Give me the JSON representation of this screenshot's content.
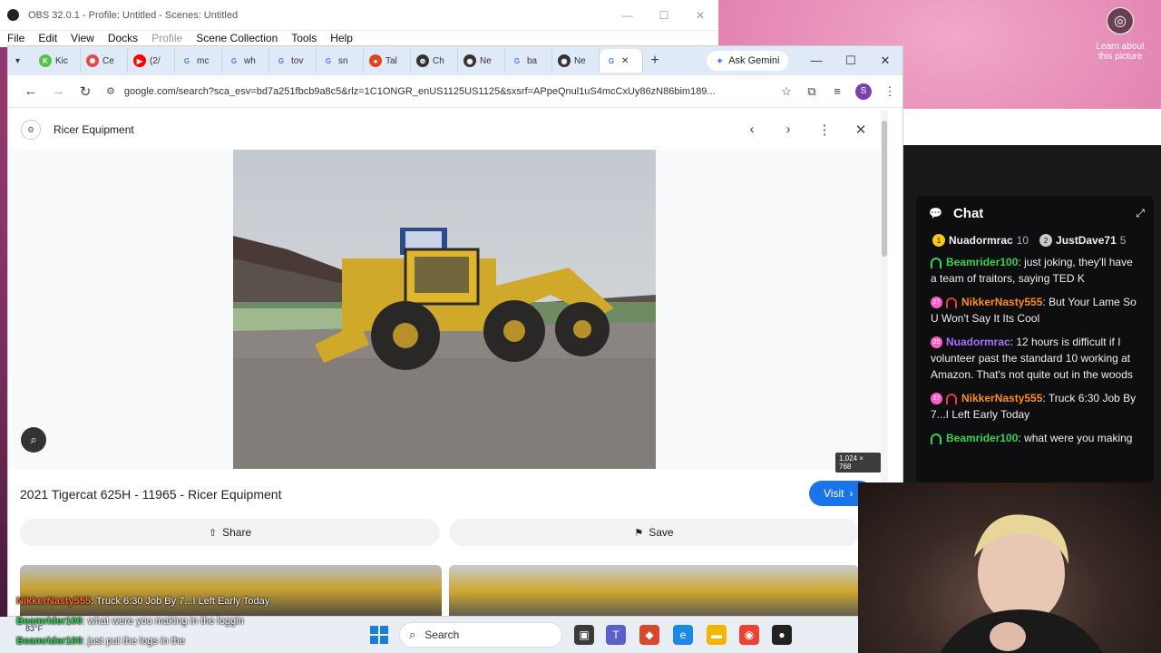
{
  "desktop": {
    "learn_about": "Learn about this picture"
  },
  "obs": {
    "title": "OBS 32.0.1 - Profile: Untitled - Scenes: Untitled",
    "menu": [
      "File",
      "Edit",
      "View",
      "Docks",
      "Profile",
      "Scene Collection",
      "Tools",
      "Help"
    ]
  },
  "chrome": {
    "tabs": [
      {
        "label": "Kic",
        "color": "#53c24b",
        "glyph": "K"
      },
      {
        "label": "Ce",
        "color": "#e34b4b",
        "glyph": "✺"
      },
      {
        "label": "(2/",
        "color": "#ff0000",
        "glyph": "▶"
      },
      {
        "label": "mc",
        "color": "#ffffff",
        "glyph": "G"
      },
      {
        "label": "wh",
        "color": "#ffffff",
        "glyph": "G"
      },
      {
        "label": "tov",
        "color": "#ffffff",
        "glyph": "G"
      },
      {
        "label": "sn",
        "color": "#ffffff",
        "glyph": "G"
      },
      {
        "label": "Tal",
        "color": "#e0451f",
        "glyph": "●"
      },
      {
        "label": "Ch",
        "color": "#333333",
        "glyph": "⊛"
      },
      {
        "label": "Ne",
        "color": "#333333",
        "glyph": "◉"
      },
      {
        "label": "ba",
        "color": "#ffffff",
        "glyph": "G"
      },
      {
        "label": "Ne",
        "color": "#333333",
        "glyph": "◉"
      }
    ],
    "ask_gemini": "Ask Gemini",
    "url": "google.com/search?sca_esv=bd7a251fbcb9a8c5&rlz=1C1ONGR_enUS1125US1125&sxsrf=APpeQnul1uS4mcCxUy86zN86bim189..."
  },
  "viewer": {
    "site_name": "Ricer Equipment",
    "dimensions": "1,024 × 768",
    "result_title": "2021 Tigercat 625H - 11965 - Ricer Equipment",
    "visit_label": "Visit",
    "share_label": "Share",
    "save_label": "Save"
  },
  "chat": {
    "title": "Chat",
    "leaders": [
      {
        "name": "Nuadormrac",
        "count": "10",
        "color": "#f5c518"
      },
      {
        "name": "JustDave71",
        "count": "5",
        "color": "#c8c8c8"
      }
    ],
    "messages": [
      {
        "sub": "",
        "user": "Beamrider100",
        "user_color": "#39d353",
        "helmet_color": "#39d353",
        "text": "just joking, they'll have a team of traitors, saying TED K"
      },
      {
        "sub": "27",
        "user": "NikkerNasty555",
        "user_color": "#ff8c1a",
        "helmet_color": "#e53935",
        "text": "But Your Lame So U Won't Say It Its Cool"
      },
      {
        "sub": "25",
        "user": "Nuadormrac",
        "user_color": "#a970ff",
        "helmet_color": "",
        "text": "12 hours is difficult if I volunteer past the standard 10 working at Amazon. That's not quite out in the woods"
      },
      {
        "sub": "27",
        "user": "NikkerNasty555",
        "user_color": "#ff8c1a",
        "helmet_color": "#e53935",
        "text": "Truck 6:30 Job By 7...I Left Early Today"
      },
      {
        "sub": "",
        "user": "Beamrider100",
        "user_color": "#39d353",
        "helmet_color": "#39d353",
        "text": "what were you making"
      }
    ]
  },
  "overlay": {
    "lines": [
      {
        "user": "NikkerNasty555",
        "text": "Truck 6:30 Job By 7...I Left Early Today",
        "cls": "u1"
      },
      {
        "user": "Beamrider100",
        "text": "what were you making in the loggin",
        "cls": "u2"
      },
      {
        "user": "Beamrider100",
        "text": "just put the logs in the",
        "cls": "u2"
      }
    ]
  },
  "taskbar": {
    "weather": "83°F",
    "search_label": "Search"
  }
}
